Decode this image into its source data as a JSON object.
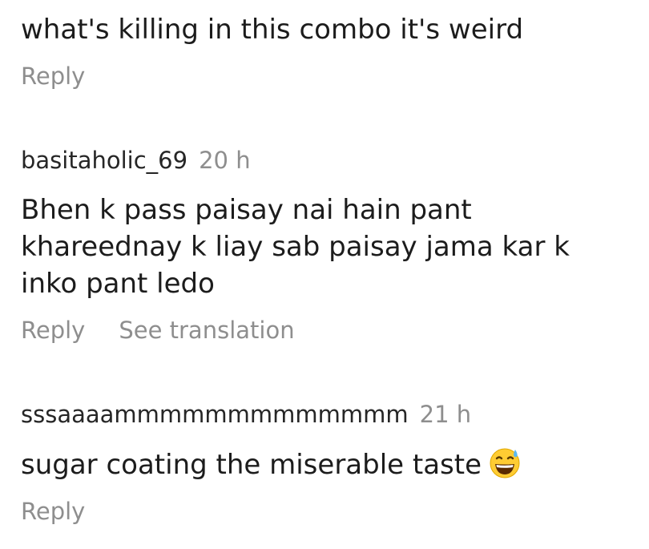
{
  "comments": [
    {
      "username": "",
      "time": "",
      "text": "what's killing in this combo it's weird",
      "actions": [
        "Reply"
      ]
    },
    {
      "username": "basitaholic_69",
      "time": "20 h",
      "text_lines": [
        "Bhen k pass paisay nai hain pant",
        "khareednay k liay sab paisay jama kar k",
        "inko pant ledo"
      ],
      "actions": [
        "Reply",
        "See translation"
      ]
    },
    {
      "username": "sssaaaammmmmmmmmmmmm",
      "time": "21 h",
      "text": "sugar coating the miserable taste",
      "emoji": "grinning-face-with-sweat-icon",
      "actions": [
        "Reply"
      ]
    }
  ],
  "colors": {
    "text": "#1c1c1c",
    "muted": "#8e8e8e",
    "emoji_face": "#ffcc33",
    "emoji_sweat": "#5bb8f0"
  }
}
